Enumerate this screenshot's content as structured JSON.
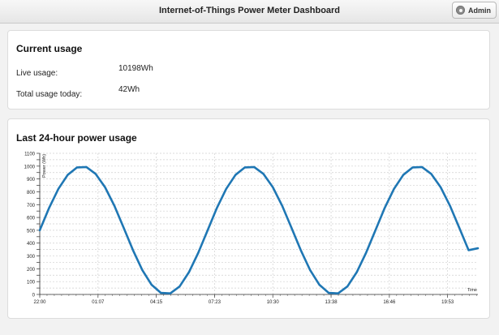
{
  "header": {
    "title": "Internet-of-Things Power Meter Dashboard",
    "admin_label": "Admin",
    "admin_icon": "gear-icon"
  },
  "current": {
    "title": "Current usage",
    "live_label": "Live usage:",
    "live_value": "10198Wh",
    "total_label": "Total usage today:",
    "total_value": "42Wh"
  },
  "chart": {
    "title": "Last 24-hour power usage"
  },
  "chart_data": {
    "type": "line",
    "ylabel": "Power (Wh)",
    "xlabel": "Time",
    "ylim": [
      0,
      1100
    ],
    "y_ticks": [
      0,
      50,
      100,
      150,
      200,
      250,
      300,
      350,
      400,
      450,
      500,
      550,
      600,
      650,
      700,
      750,
      800,
      850,
      900,
      950,
      1000,
      1050,
      1100
    ],
    "y_tick_labels": [
      "0",
      "",
      "100",
      "",
      "200",
      "",
      "300",
      "",
      "400",
      "",
      "500",
      "",
      "600",
      "",
      "700",
      "",
      "800",
      "",
      "900",
      "",
      "1000",
      "",
      "1100"
    ],
    "x_tick_labels": [
      "22:00",
      "01:07",
      "04:15",
      "07:23",
      "10:30",
      "13:38",
      "16:46",
      "19:53"
    ],
    "x_range_minutes": [
      0,
      1410
    ],
    "series": [
      {
        "color": "#1f77b4",
        "x_minutes": [
          0,
          30,
          60,
          90,
          120,
          150,
          180,
          210,
          240,
          270,
          300,
          330,
          360,
          390,
          420,
          450,
          480,
          510,
          540,
          570,
          600,
          630,
          660,
          690,
          720,
          750,
          780,
          810,
          840,
          870,
          900,
          930,
          960,
          990,
          1020,
          1050,
          1080,
          1110,
          1140,
          1170,
          1200,
          1230,
          1260,
          1290,
          1320,
          1350,
          1380,
          1410
        ],
        "values": [
          500,
          674,
          823,
          932,
          990,
          993,
          939,
          836,
          692,
          520,
          345,
          190,
          75,
          12,
          8,
          62,
          173,
          324,
          499,
          674,
          823,
          932,
          990,
          993,
          939,
          836,
          692,
          520,
          345,
          190,
          75,
          12,
          8,
          62,
          173,
          324,
          499,
          674,
          823,
          932,
          990,
          993,
          939,
          836,
          692,
          520,
          345,
          360
        ]
      }
    ]
  }
}
